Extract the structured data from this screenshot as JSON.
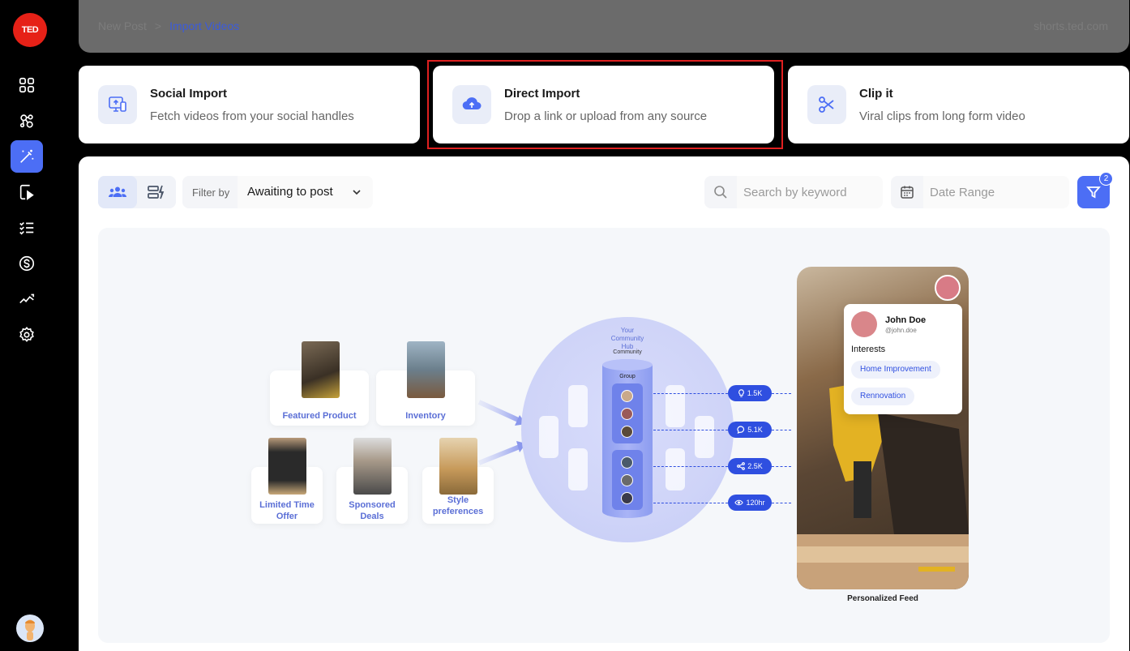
{
  "logo": {
    "text": "TED"
  },
  "breadcrumb": {
    "parent": "New Post",
    "separator": ">",
    "current": "Import Videos"
  },
  "domain": "shorts.ted.com",
  "import_cards": [
    {
      "title": "Social Import",
      "subtitle": "Fetch videos from your social handles",
      "icon": "monitor-upload-icon"
    },
    {
      "title": "Direct Import",
      "subtitle": "Drop a link or upload from any source",
      "icon": "cloud-upload-icon"
    },
    {
      "title": "Clip it",
      "subtitle": "Viral clips from long form video",
      "icon": "scissors-icon"
    }
  ],
  "toolbar": {
    "filter_label": "Filter by",
    "filter_value": "Awaiting to post",
    "search_placeholder": "Search by keyword",
    "date_placeholder": "Date Range",
    "filter_count": "2"
  },
  "illustration": {
    "products": [
      "Featured Product",
      "Inventory",
      "Limited Time Offer",
      "Sponsored Deals",
      "Style preferences"
    ],
    "hub_title": "Your Community Hub",
    "hub_community": "Community",
    "hub_group": "Group",
    "stats": [
      "1.5K",
      "5.1K",
      "2.5K",
      "120hr"
    ],
    "feed_label": "Personalized Feed",
    "user": {
      "name": "John Doe",
      "handle": "@john.doe",
      "interests_label": "Interests",
      "interests": [
        "Home Improvement",
        "Rennovation"
      ]
    }
  },
  "colors": {
    "accent": "#4c6ef5",
    "brand": "#e62117",
    "highlight": "#e02020"
  }
}
